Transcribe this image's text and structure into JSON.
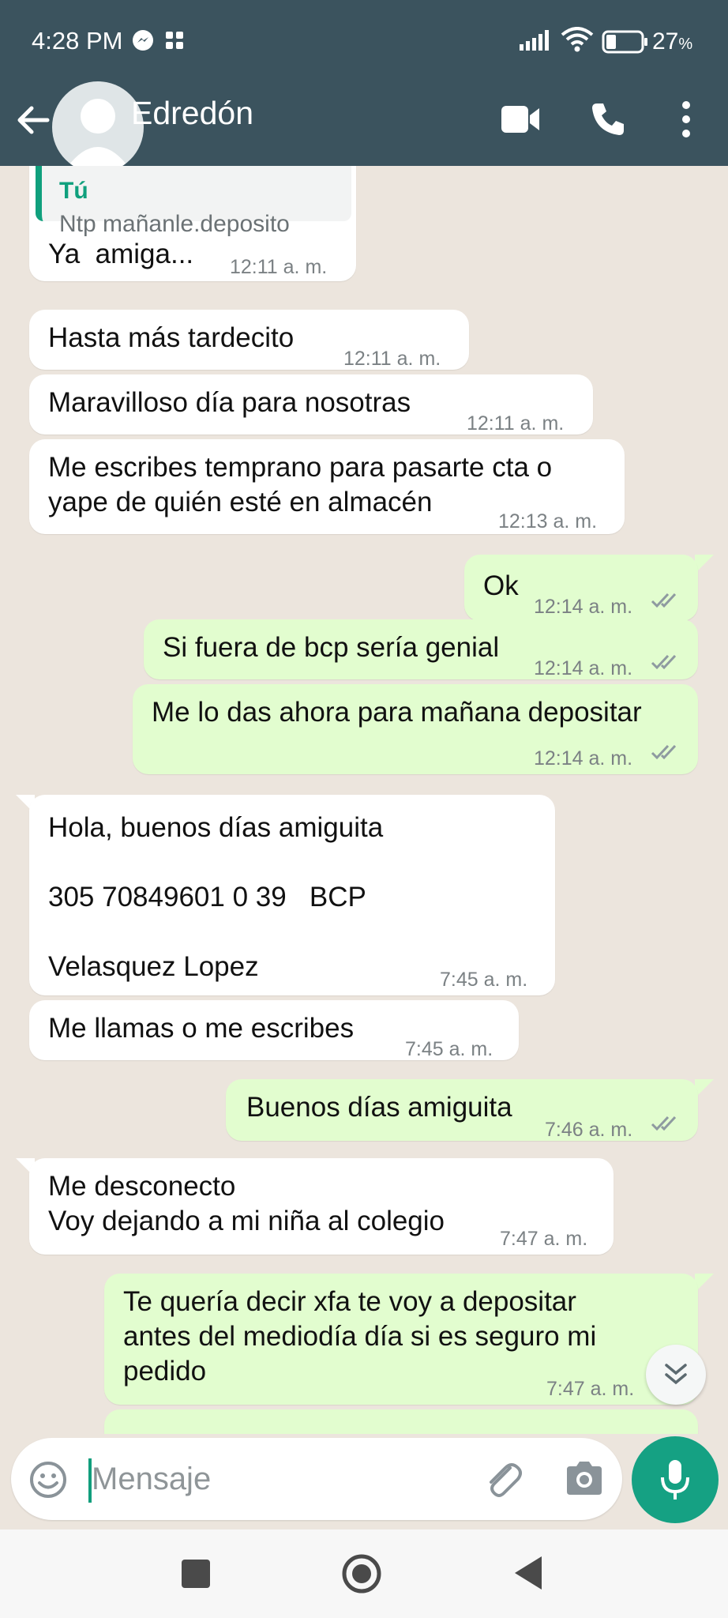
{
  "status_bar": {
    "time": "4:28 PM",
    "battery_percent": "27",
    "battery_unit": "%"
  },
  "header": {
    "contact_name": "Edredón",
    "background_color": "#3b535e"
  },
  "messages": [
    {
      "direction": "in",
      "quote": {
        "author": "Tú",
        "text": "Ntp mañanle.deposito"
      },
      "text": "Ya  amiga...",
      "time": "12:11 a. m."
    },
    {
      "direction": "in",
      "text": "Hasta más tardecito",
      "time": "12:11 a. m."
    },
    {
      "direction": "in",
      "text": "Maravilloso día para nosotras",
      "time": "12:11 a. m."
    },
    {
      "direction": "in",
      "lines": [
        "Me escribes temprano para pasarte cta o",
        "yape de quién esté en almacén"
      ],
      "time": "12:13 a. m."
    },
    {
      "direction": "out",
      "text": "Ok",
      "time": "12:14 a. m."
    },
    {
      "direction": "out",
      "text": "Si fuera de bcp sería genial",
      "time": "12:14 a. m."
    },
    {
      "direction": "out",
      "text": "Me lo das ahora para mañana depositar",
      "time": "12:14 a. m."
    },
    {
      "direction": "in",
      "lines": [
        "Hola, buenos días amiguita",
        "305 70849601 0 39   BCP",
        "Velasquez Lopez"
      ],
      "time": "7:45 a. m."
    },
    {
      "direction": "in",
      "text": "Me llamas o me escribes",
      "time": "7:45 a. m."
    },
    {
      "direction": "out",
      "text": "Buenos días amiguita",
      "time": "7:46 a. m."
    },
    {
      "direction": "in",
      "lines": [
        "Me desconecto",
        "Voy dejando a mi niña al colegio"
      ],
      "time": "7:47 a. m."
    },
    {
      "direction": "out",
      "lines": [
        "Te quería decir xfa te voy a depositar",
        "antes del mediodía día si es seguro mi",
        "pedido"
      ],
      "time": "7:47 a. m."
    }
  ],
  "composer": {
    "placeholder": "Mensaje"
  },
  "colors": {
    "incoming_bubble": "#ffffff",
    "outgoing_bubble": "#e2fdcf",
    "accent": "#15a183",
    "read_ticks": "#8e9aa0"
  },
  "icons": {
    "header": [
      "back-arrow-icon",
      "avatar-icon",
      "video-call-icon",
      "phone-icon",
      "more-vert-icon"
    ],
    "composer": [
      "emoji-icon",
      "attach-icon",
      "camera-icon",
      "mic-icon"
    ],
    "navbar": [
      "recents-square-icon",
      "home-circle-icon",
      "back-triangle-icon"
    ]
  }
}
